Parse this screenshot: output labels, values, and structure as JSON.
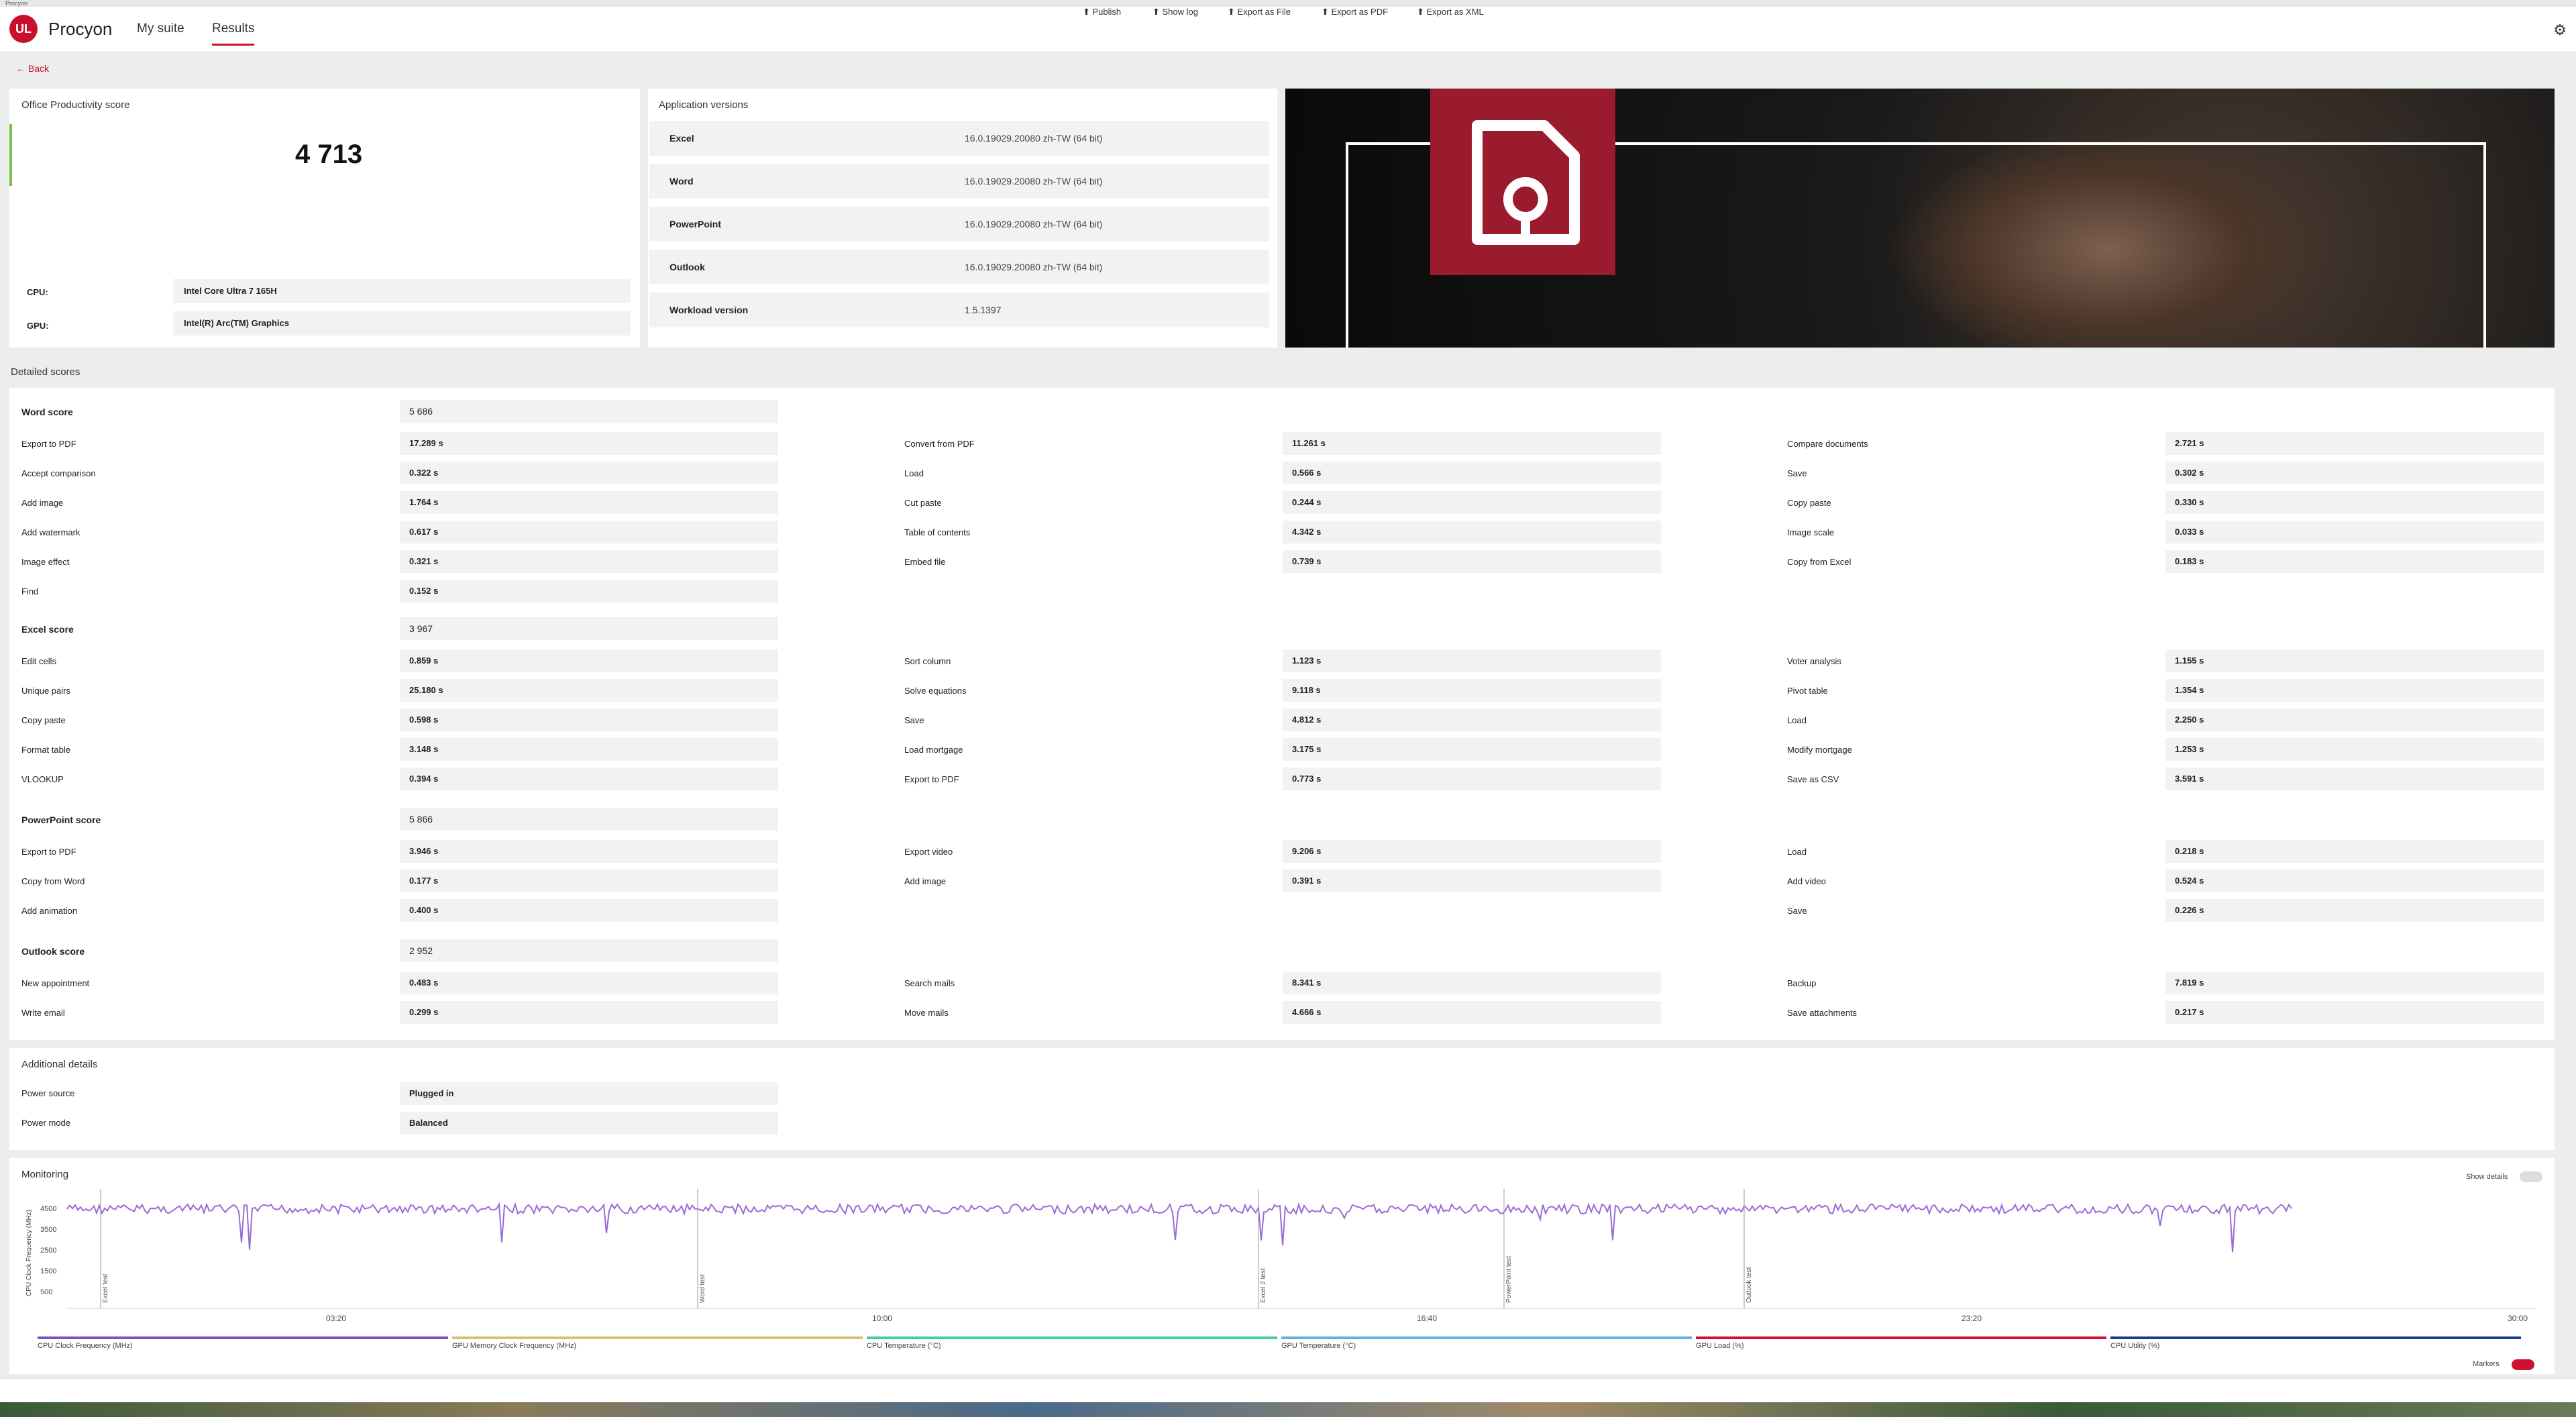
{
  "window": {
    "title": "Procyon"
  },
  "header": {
    "logo": "UL",
    "app_name": "Procyon",
    "tabs": [
      {
        "label": "My suite"
      },
      {
        "label": "Results"
      }
    ],
    "settings_icon": "gear-icon"
  },
  "back": {
    "label": "Back"
  },
  "summary": {
    "title": "Office Productivity score",
    "score": "4 713",
    "cpu_label": "CPU:",
    "cpu_value": "Intel Core Ultra 7 165H",
    "gpu_label": "GPU:",
    "gpu_value": "Intel(R) Arc(TM) Graphics"
  },
  "versions": {
    "title": "Application versions",
    "rows": [
      {
        "name": "Excel",
        "value": "16.0.19029.20080 zh-TW (64 bit)"
      },
      {
        "name": "Word",
        "value": "16.0.19029.20080 zh-TW (64 bit)"
      },
      {
        "name": "PowerPoint",
        "value": "16.0.19029.20080 zh-TW (64 bit)"
      },
      {
        "name": "Outlook",
        "value": "16.0.19029.20080 zh-TW (64 bit)"
      },
      {
        "name": "Workload version",
        "value": "1.5.1397"
      }
    ]
  },
  "detailed": {
    "title": "Detailed scores",
    "word": {
      "label": "Word score",
      "score": "5 686",
      "rows": [
        [
          "Export to PDF",
          "17.289 s",
          "Convert from PDF",
          "11.261 s",
          "Compare documents",
          "2.721 s"
        ],
        [
          "Accept comparison",
          "0.322 s",
          "Load",
          "0.566 s",
          "Save",
          "0.302 s"
        ],
        [
          "Add image",
          "1.764 s",
          "Cut paste",
          "0.244 s",
          "Copy paste",
          "0.330 s"
        ],
        [
          "Add watermark",
          "0.617 s",
          "Table of contents",
          "4.342 s",
          "Image scale",
          "0.033 s"
        ],
        [
          "Image effect",
          "0.321 s",
          "Embed file",
          "0.739 s",
          "Copy from Excel",
          "0.183 s"
        ],
        [
          "Find",
          "0.152 s",
          "",
          "",
          "",
          ""
        ]
      ]
    },
    "excel": {
      "label": "Excel score",
      "score": "3 967",
      "rows": [
        [
          "Edit cells",
          "0.859 s",
          "Sort column",
          "1.123 s",
          "Voter analysis",
          "1.155 s"
        ],
        [
          "Unique pairs",
          "25.180 s",
          "Solve equations",
          "9.118 s",
          "Pivot table",
          "1.354 s"
        ],
        [
          "Copy paste",
          "0.598 s",
          "Save",
          "4.812 s",
          "Load",
          "2.250 s"
        ],
        [
          "Format table",
          "3.148 s",
          "Load mortgage",
          "3.175 s",
          "Modify mortgage",
          "1.253 s"
        ],
        [
          "VLOOKUP",
          "0.394 s",
          "Export to PDF",
          "0.773 s",
          "Save as CSV",
          "3.591 s"
        ]
      ]
    },
    "powerpoint": {
      "label": "PowerPoint score",
      "score": "5 866",
      "rows": [
        [
          "Export to PDF",
          "3.946 s",
          "Export video",
          "9.206 s",
          "Load",
          "0.218 s"
        ],
        [
          "Copy from Word",
          "0.177 s",
          "Add image",
          "0.391 s",
          "Add video",
          "0.524 s"
        ],
        [
          "Add animation",
          "0.400 s",
          "",
          "",
          "Save",
          "0.226 s"
        ]
      ]
    },
    "outlook": {
      "label": "Outlook score",
      "score": "2 952",
      "rows": [
        [
          "New appointment",
          "0.483 s",
          "Search mails",
          "8.341 s",
          "Backup",
          "7.819 s"
        ],
        [
          "Write email",
          "0.299 s",
          "Move mails",
          "4.666 s",
          "Save attachments",
          "0.217 s"
        ]
      ]
    }
  },
  "additional": {
    "title": "Additional details",
    "rows": [
      {
        "label": "Power source",
        "value": "Plugged in"
      },
      {
        "label": "Power mode",
        "value": "Balanced"
      }
    ]
  },
  "monitoring": {
    "title": "Monitoring",
    "show_details": "Show details",
    "ylabel": "CPU Clock Frequency (MHz)",
    "yticks": [
      "4500",
      "3500",
      "2500",
      "1500",
      "500"
    ],
    "xticks": [
      "03:20",
      "10:00",
      "16:40",
      "23:20",
      "30:00"
    ],
    "markers": [
      "Excel test",
      "Word test",
      "Excel 2 test",
      "PowerPoint test",
      "Outlook test"
    ],
    "legend": [
      {
        "label": "CPU Clock Frequency (MHz)",
        "color": "#7b4fc9"
      },
      {
        "label": "GPU Memory Clock Frequency (MHz)",
        "color": "#d8c070"
      },
      {
        "label": "CPU Temperature (°C)",
        "color": "#40d0a0"
      },
      {
        "label": "GPU Temperature (°C)",
        "color": "#60b0e0"
      },
      {
        "label": "GPU Load (%)",
        "color": "#d01030"
      },
      {
        "label": "CPU Utility (%)",
        "color": "#1a3a8a"
      }
    ],
    "markers_label": "Markers"
  },
  "bottombar": {
    "buttons": [
      "Publish",
      "Show log",
      "Export as File",
      "Export as PDF",
      "Export as XML"
    ]
  }
}
